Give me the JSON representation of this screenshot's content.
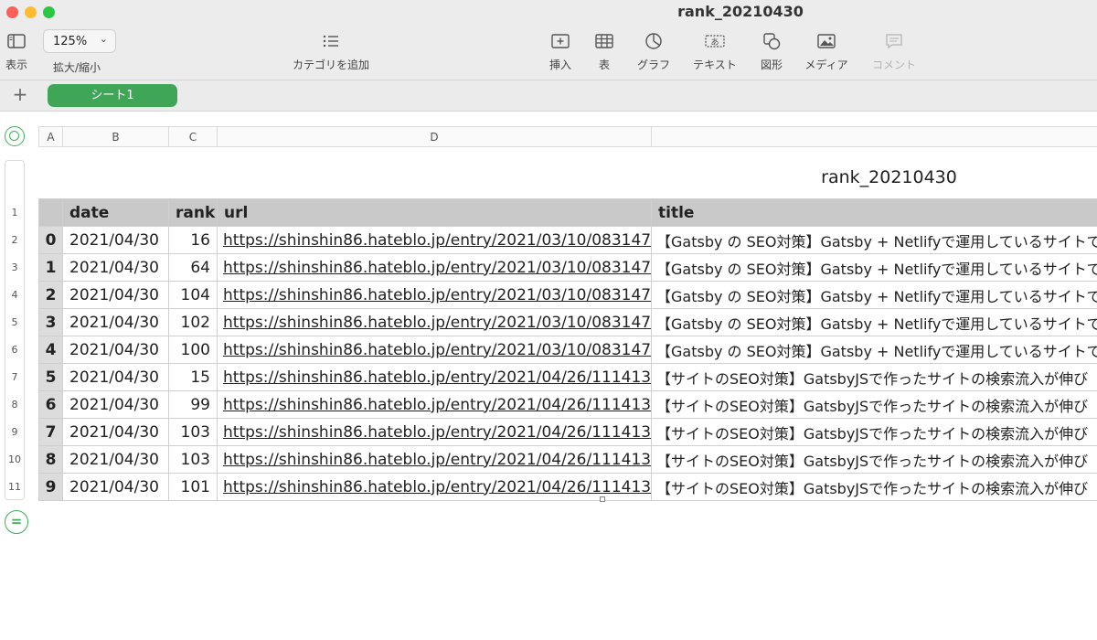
{
  "window": {
    "title": "rank_20210430"
  },
  "toolbar": {
    "view_label": "表示",
    "zoom_value": "125%",
    "zoom_label": "拡大/縮小",
    "category_label": "カテゴリを追加",
    "insert_label": "挿入",
    "table_label": "表",
    "chart_label": "グラフ",
    "text_label": "テキスト",
    "shape_label": "図形",
    "media_label": "メディア",
    "comment_label": "コメント"
  },
  "sheets": {
    "add_icon": "plus-icon",
    "active": "シート1"
  },
  "columns": [
    "A",
    "B",
    "C",
    "D"
  ],
  "table": {
    "title": "rank_20210430",
    "headers": [
      "",
      "date",
      "rank",
      "url",
      "title"
    ],
    "row_numbers": [
      "1",
      "2",
      "3",
      "4",
      "5",
      "6",
      "7",
      "8",
      "9",
      "10",
      "11"
    ],
    "rows": [
      [
        "0",
        "2021/04/30",
        "16",
        "https://shinshin86.hateblo.jp/entry/2021/03/10/083147",
        "【Gatsby の SEO対策】Gatsby + Netlifyで運用しているサイトで"
      ],
      [
        "1",
        "2021/04/30",
        "64",
        "https://shinshin86.hateblo.jp/entry/2021/03/10/083147",
        "【Gatsby の SEO対策】Gatsby + Netlifyで運用しているサイトで"
      ],
      [
        "2",
        "2021/04/30",
        "104",
        "https://shinshin86.hateblo.jp/entry/2021/03/10/083147",
        "【Gatsby の SEO対策】Gatsby + Netlifyで運用しているサイトで"
      ],
      [
        "3",
        "2021/04/30",
        "102",
        "https://shinshin86.hateblo.jp/entry/2021/03/10/083147",
        "【Gatsby の SEO対策】Gatsby + Netlifyで運用しているサイトで"
      ],
      [
        "4",
        "2021/04/30",
        "100",
        "https://shinshin86.hateblo.jp/entry/2021/03/10/083147",
        "【Gatsby の SEO対策】Gatsby + Netlifyで運用しているサイトで"
      ],
      [
        "5",
        "2021/04/30",
        "15",
        "https://shinshin86.hateblo.jp/entry/2021/04/26/111413",
        "【サイトのSEO対策】GatsbyJSで作ったサイトの検索流入が伸び"
      ],
      [
        "6",
        "2021/04/30",
        "99",
        "https://shinshin86.hateblo.jp/entry/2021/04/26/111413",
        "【サイトのSEO対策】GatsbyJSで作ったサイトの検索流入が伸び"
      ],
      [
        "7",
        "2021/04/30",
        "103",
        "https://shinshin86.hateblo.jp/entry/2021/04/26/111413",
        "【サイトのSEO対策】GatsbyJSで作ったサイトの検索流入が伸び"
      ],
      [
        "8",
        "2021/04/30",
        "103",
        "https://shinshin86.hateblo.jp/entry/2021/04/26/111413",
        "【サイトのSEO対策】GatsbyJSで作ったサイトの検索流入が伸び"
      ],
      [
        "9",
        "2021/04/30",
        "101",
        "https://shinshin86.hateblo.jp/entry/2021/04/26/111413",
        "【サイトのSEO対策】GatsbyJSで作ったサイトの検索流入が伸び"
      ]
    ]
  },
  "colors": {
    "accent": "#3fa557",
    "header_bg": "#c9c9c9",
    "index_bg": "#dcdcdc"
  }
}
